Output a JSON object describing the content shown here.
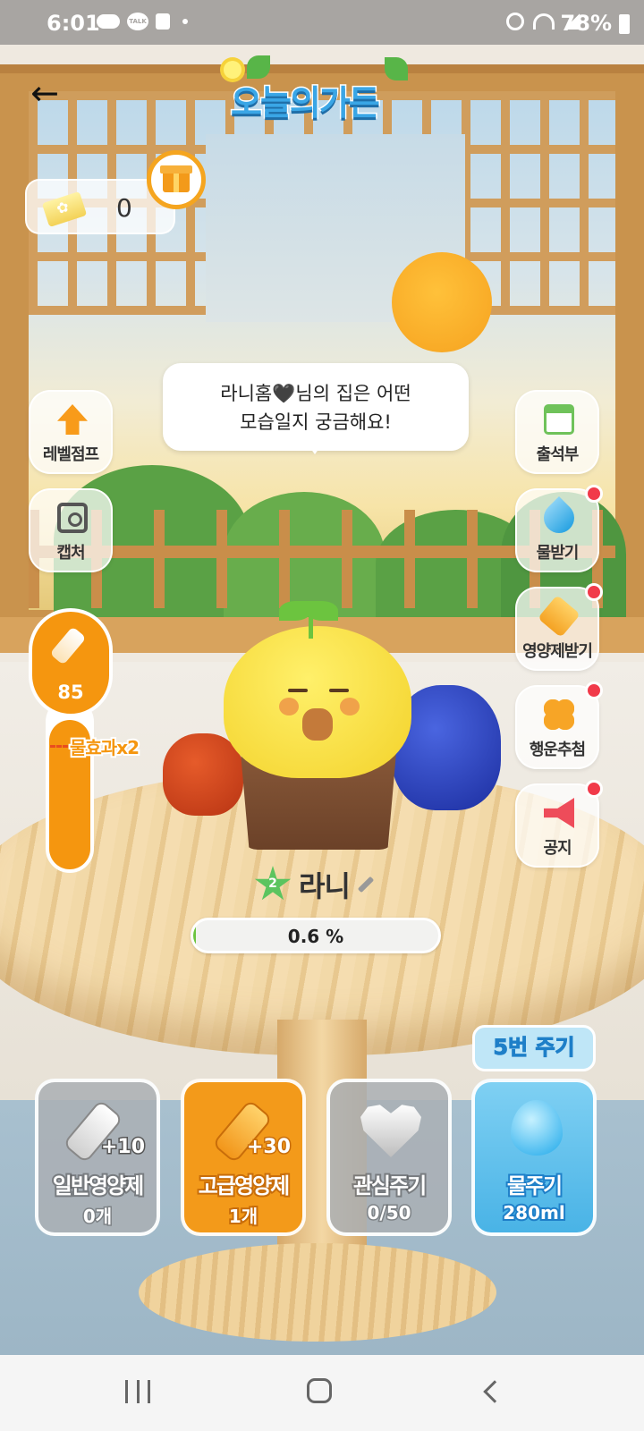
{
  "status_bar": {
    "time": "6:01",
    "talk_icon_text": "TALK",
    "battery": "78%"
  },
  "header": {
    "logo_text": "오늘의가든",
    "back_icon": "arrow-left-icon"
  },
  "ticket": {
    "count": "0",
    "gift_icon": "gift-icon"
  },
  "speech_bubble": {
    "line1": "라니홈🖤님의 집은 어떤",
    "line2": "모습일지 궁금해요!"
  },
  "left_buttons": [
    {
      "label": "레벨점프",
      "icon": "level-up-arrow-icon"
    },
    {
      "label": "캡처",
      "icon": "camera-icon"
    }
  ],
  "right_buttons": [
    {
      "label": "출석부",
      "icon": "calendar-icon",
      "badge": false
    },
    {
      "label": "물받기",
      "icon": "water-drop-icon",
      "badge": true
    },
    {
      "label": "영양제받기",
      "icon": "nutrient-bottle-icon",
      "badge": true
    },
    {
      "label": "행운추첨",
      "icon": "clover-icon",
      "badge": true
    },
    {
      "label": "공지",
      "icon": "megaphone-icon",
      "badge": true
    }
  ],
  "nutrient_gauge": {
    "value": "85",
    "water_effect": "물효과x2",
    "accent_color": "#f5960f"
  },
  "pet": {
    "level": "2",
    "name": "라니",
    "progress_text": "0.6 %",
    "progress_fraction": 0.006
  },
  "water_badge": "5번 주기",
  "actions": [
    {
      "title": "일반영양제",
      "sub": "0개",
      "plus": "+10",
      "icon": "nutrient-bottle-icon"
    },
    {
      "title": "고급영양제",
      "sub": "1개",
      "plus": "+30",
      "icon": "premium-nutrient-icon"
    },
    {
      "title": "관심주기",
      "sub": "0/50",
      "icon": "heart-icon"
    },
    {
      "title": "물주기",
      "sub": "280ml",
      "icon": "water-drop-icon"
    }
  ]
}
